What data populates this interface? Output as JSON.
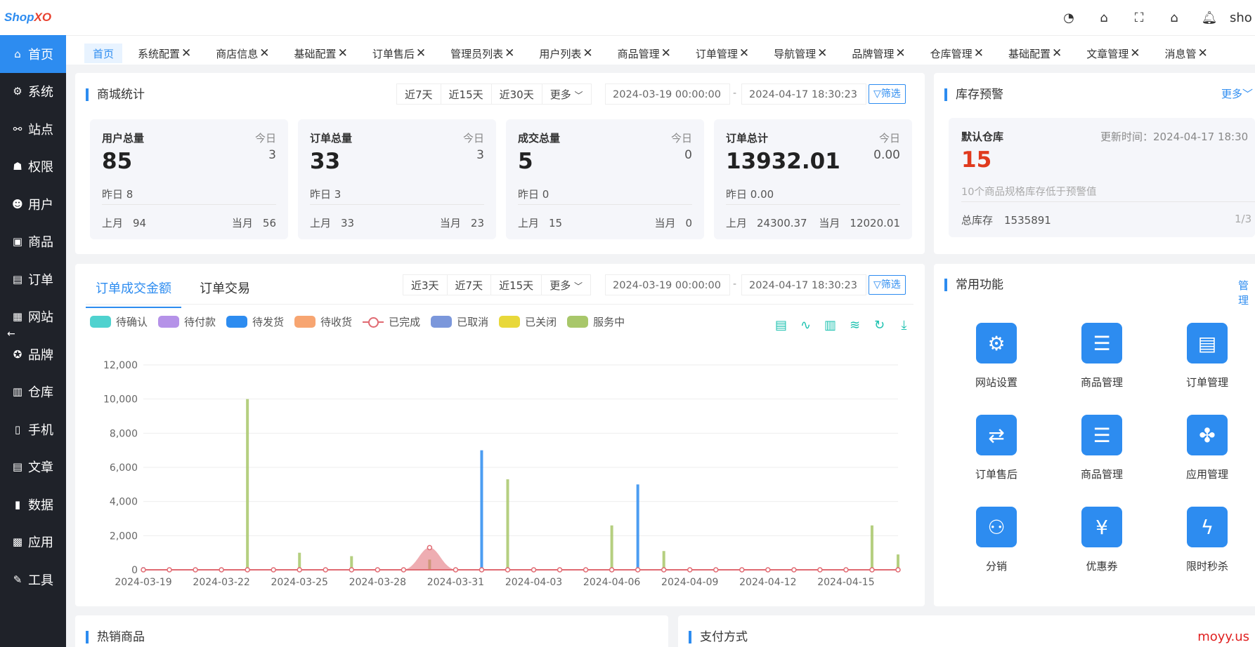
{
  "app": {
    "logo_a": "Shop",
    "logo_b": "XO",
    "user": "sho"
  },
  "sidebar": {
    "items": [
      {
        "label": "首页",
        "icon": "home-icon"
      },
      {
        "label": "系统",
        "icon": "gear-icon"
      },
      {
        "label": "站点",
        "icon": "site-icon"
      },
      {
        "label": "权限",
        "icon": "permission-icon"
      },
      {
        "label": "用户",
        "icon": "user-icon"
      },
      {
        "label": "商品",
        "icon": "goods-icon"
      },
      {
        "label": "订单",
        "icon": "order-icon"
      },
      {
        "label": "网站",
        "icon": "website-icon"
      },
      {
        "label": "品牌",
        "icon": "brand-icon"
      },
      {
        "label": "仓库",
        "icon": "warehouse-icon"
      },
      {
        "label": "手机",
        "icon": "mobile-icon"
      },
      {
        "label": "文章",
        "icon": "article-icon"
      },
      {
        "label": "数据",
        "icon": "data-icon"
      },
      {
        "label": "应用",
        "icon": "app-icon"
      },
      {
        "label": "工具",
        "icon": "tool-icon"
      }
    ]
  },
  "tabs": [
    "首页",
    "系统配置",
    "商店信息",
    "基础配置",
    "订单售后",
    "管理员列表",
    "用户列表",
    "商品管理",
    "订单管理",
    "导航管理",
    "品牌管理",
    "仓库管理",
    "基础配置",
    "文章管理",
    "消息管"
  ],
  "mall_stats": {
    "title": "商城统计",
    "ranges": [
      "近7天",
      "近15天",
      "近30天",
      "更多"
    ],
    "date_start": "2024-03-19 00:00:00",
    "date_end": "2024-04-17 18:30:23",
    "dash": "-",
    "filter": "筛选",
    "cards": [
      {
        "label": "用户总量",
        "today_label": "今日",
        "value": "85",
        "today": "3",
        "yesterday": "昨日  8",
        "last_month_label": "上月",
        "last_month": "94",
        "this_month_label": "当月",
        "this_month": "56"
      },
      {
        "label": "订单总量",
        "today_label": "今日",
        "value": "33",
        "today": "3",
        "yesterday": "昨日 3",
        "last_month_label": "上月",
        "last_month": "33",
        "this_month_label": "当月",
        "this_month": "23"
      },
      {
        "label": "成交总量",
        "today_label": "今日",
        "value": "5",
        "today": "0",
        "yesterday": "昨日 0",
        "last_month_label": "上月",
        "last_month": "15",
        "this_month_label": "当月",
        "this_month": "0"
      },
      {
        "label": "订单总计",
        "today_label": "今日",
        "value": "13932.01",
        "today": "0.00",
        "yesterday": "昨日 0.00",
        "last_month_label": "上月",
        "last_month": "24300.37",
        "this_month_label": "当月",
        "this_month": "12020.01"
      }
    ]
  },
  "stock": {
    "title": "库存预警",
    "more": "更多",
    "warehouse": "默认仓库",
    "update_label": "更新时间：2024-04-17 18:30",
    "count": "15",
    "note": "10个商品规格库存低于预警值",
    "total_label": "总库存",
    "total": "1535891",
    "page": "1/3"
  },
  "order_chart": {
    "tabs": [
      "订单成交金额",
      "订单交易"
    ],
    "ranges": [
      "近3天",
      "近7天",
      "近15天",
      "更多"
    ],
    "date_start": "2024-03-19 00:00:00",
    "date_end": "2024-04-17 18:30:23",
    "dash": "-",
    "filter": "筛选",
    "legend": [
      {
        "name": "待确认",
        "color": "#4fd2cf"
      },
      {
        "name": "待付款",
        "color": "#b592e8"
      },
      {
        "name": "待发货",
        "color": "#2d8cf0"
      },
      {
        "name": "待收货",
        "color": "#f7a571"
      },
      {
        "name": "已完成",
        "color": "#e06a72",
        "style": "line"
      },
      {
        "name": "已取消",
        "color": "#7b97db"
      },
      {
        "name": "已关闭",
        "color": "#e8d83a"
      },
      {
        "name": "服务中",
        "color": "#a8c76a"
      }
    ],
    "tools": [
      "document-icon",
      "line-chart-icon",
      "bar-chart-icon",
      "stack-icon",
      "refresh-icon",
      "download-icon"
    ]
  },
  "chart_data": {
    "type": "line",
    "x_ticks": [
      "2024-03-19",
      "2024-03-22",
      "2024-03-25",
      "2024-03-28",
      "2024-03-31",
      "2024-04-03",
      "2024-04-06",
      "2024-04-09",
      "2024-04-12",
      "2024-04-15"
    ],
    "x_count": 30,
    "y_ticks": [
      "0",
      "2,000",
      "4,000",
      "6,000",
      "8,000",
      "10,000",
      "12,000"
    ],
    "ylim": [
      0,
      12000
    ],
    "series": [
      {
        "name": "待发货",
        "color": "#2d8cf0",
        "kind": "bar",
        "points": [
          [
            0,
            150
          ],
          [
            13,
            7000
          ],
          [
            19,
            5000
          ]
        ]
      },
      {
        "name": "已完成",
        "color": "#e06a72",
        "kind": "area",
        "points": [
          [
            11,
            1300
          ]
        ]
      },
      {
        "name": "服务中",
        "color": "#a8c76a",
        "kind": "bar",
        "points": [
          [
            4,
            10000
          ],
          [
            6,
            1000
          ],
          [
            8,
            800
          ],
          [
            11,
            600
          ],
          [
            14,
            5300
          ],
          [
            18,
            2600
          ],
          [
            20,
            1100
          ],
          [
            28,
            2600
          ],
          [
            29,
            900
          ]
        ]
      }
    ]
  },
  "quick": {
    "title": "常用功能",
    "manage": "管理",
    "items": [
      {
        "label": "网站设置",
        "icon": "site-settings-icon"
      },
      {
        "label": "商品管理",
        "icon": "goods-manage-icon"
      },
      {
        "label": "订单管理",
        "icon": "order-manage-icon"
      },
      {
        "label": "订单售后",
        "icon": "aftersale-icon"
      },
      {
        "label": "商品管理",
        "icon": "goods-manage-icon"
      },
      {
        "label": "应用管理",
        "icon": "app-manage-icon"
      },
      {
        "label": "分销",
        "icon": "distribution-icon"
      },
      {
        "label": "优惠券",
        "icon": "coupon-icon"
      },
      {
        "label": "限时秒杀",
        "icon": "flash-sale-icon"
      }
    ]
  },
  "bottom": {
    "hot": "热销商品",
    "pay": "支付方式"
  },
  "watermark": "moyy.us"
}
